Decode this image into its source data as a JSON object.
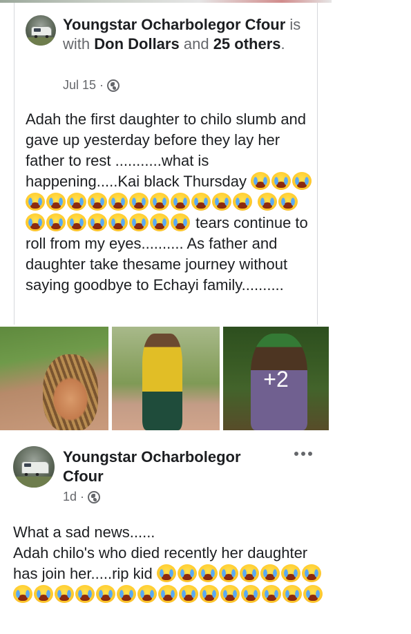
{
  "post1": {
    "author": "Youngstar Ocharbolegor Cfour",
    "with_text": "is with",
    "tagged": "Don Dollars",
    "and_text": "and",
    "others": "25 others",
    "period": ".",
    "time": "Jul 15",
    "separator": "·",
    "privacy_icon": "globe-icon",
    "text_part1": "Adah the first daughter to chilo slumb and gave up yesterday before they lay her father to rest ...........what is happening.....Kai black Thursday",
    "emoji_count_1": 14,
    "text_part2": "tears continue to roll from my eyes.......... As father and daughter take thesame journey without saying goodbye to Echayi family..........",
    "emoji_count_2": 10,
    "emoji_name": "loudly-crying-face-emoji"
  },
  "photos": {
    "more_count": "+2"
  },
  "post2": {
    "author": "Youngstar Ocharbolegor Cfour",
    "time": "1d",
    "separator": "·",
    "privacy_icon": "globe-icon",
    "more_icon": "more-options-icon",
    "line1": "What a sad news......",
    "text": "Adah chilo's who died recently her daughter has join her.....rip kid",
    "emoji_count": 23
  }
}
